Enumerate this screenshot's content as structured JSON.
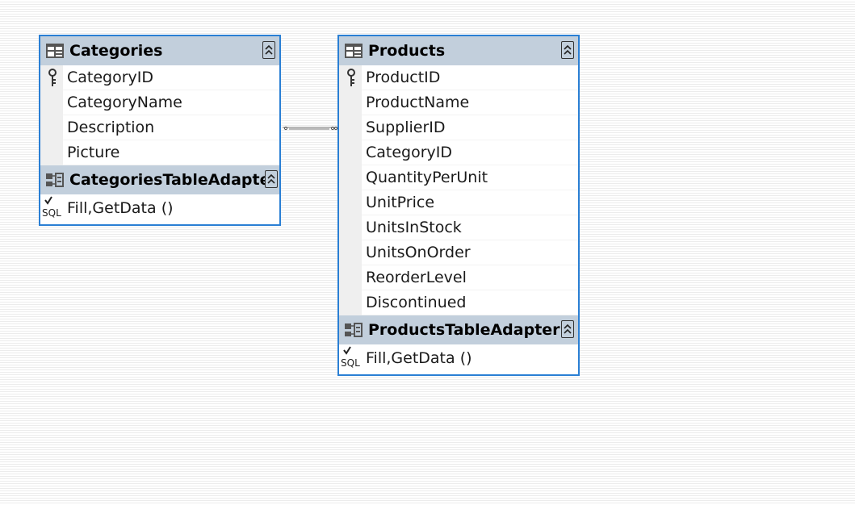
{
  "categories": {
    "title": "Categories",
    "columns": [
      "CategoryID",
      "CategoryName",
      "Description",
      "Picture"
    ],
    "key_column": "CategoryID",
    "adapter": {
      "title": "CategoriesTableAdapter",
      "method": "Fill,GetData ()"
    }
  },
  "products": {
    "title": "Products",
    "columns": [
      "ProductID",
      "ProductName",
      "SupplierID",
      "CategoryID",
      "QuantityPerUnit",
      "UnitPrice",
      "UnitsInStock",
      "UnitsOnOrder",
      "ReorderLevel",
      "Discontinued"
    ],
    "key_column": "ProductID",
    "adapter": {
      "title": "ProductsTableAdapter",
      "method": "Fill,GetData ()"
    }
  },
  "colors": {
    "border": "#2a7fd4",
    "header": "#c2cfdc",
    "gutter": "#efefef"
  },
  "icons": {
    "table": "datatable-icon",
    "adapter": "tableadapter-icon",
    "key": "primary-key-icon",
    "query": "sql-query-icon",
    "collapse": "collapse-chevron-icon"
  }
}
